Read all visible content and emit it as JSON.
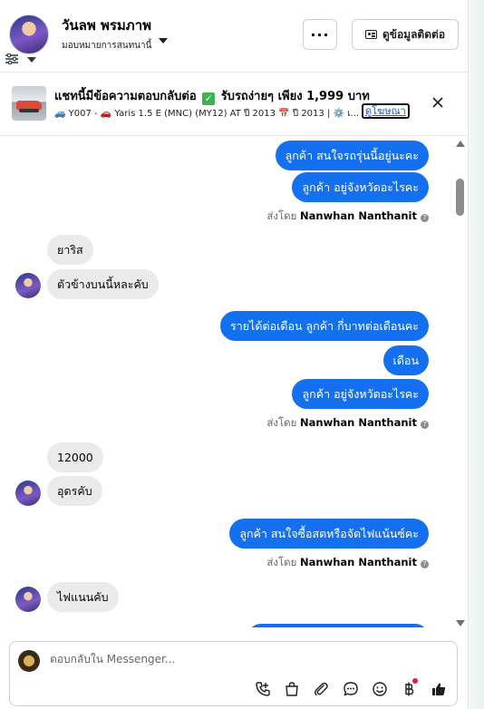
{
  "header": {
    "name": "วันลพ พรมภาพ",
    "assign_label": "มอบหมายการสนทนานี้",
    "more_label": "···",
    "contact_button": "ดูข้อมูลติดต่อ"
  },
  "ad": {
    "title_part1": "แชทนี้มีข้อความตอบกลับต่อ",
    "title_part2": "รับรถง่ายๆ เพียง 1,999 บาท",
    "subtitle": "🚙 Y007 - 🚗 Yaris 1.5 E (MNC) (MY12) AT ปี 2013 📅 ปี 2013 | ⚙️ เ...",
    "link": "ดูโฆษณา"
  },
  "messages": [
    {
      "dir": "out",
      "text": "ลูกค้า สนใจรถรุ่นนี้อยู่นะคะ"
    },
    {
      "dir": "out",
      "text": "ลูกค้า อยู่จังหวัดอะไรคะ"
    },
    {
      "dir": "in",
      "text": "ยาริส"
    },
    {
      "dir": "in",
      "text": "ตัวข้างบนนี้หละคับ"
    },
    {
      "dir": "out",
      "text": "รายได้ต่อเดือน ลูกค้า กี่บาทต่อเดือนคะ"
    },
    {
      "dir": "out",
      "text": "เดือน"
    },
    {
      "dir": "out",
      "text": "ลูกค้า อยู่จังหวัดอะไรคะ"
    },
    {
      "dir": "in",
      "text": "12000"
    },
    {
      "dir": "in",
      "text": "อุดรคับ"
    },
    {
      "dir": "out",
      "text": "ลูกค้า สนใจซื้อสดหรือจัดไฟแน้นซ์คะ"
    },
    {
      "dir": "in",
      "text": "ไฟแนนคับ"
    }
  ],
  "sent_by": {
    "prefix": "ส่งโดย",
    "agent": "Nanwhan Nanthanit"
  },
  "composer": {
    "placeholder": "ตอบกลับใน Messenger..."
  },
  "colors": {
    "outgoing_bubble": "#1570ef",
    "incoming_bubble": "#e9eaec",
    "notification_dot": "#e41e3f"
  }
}
